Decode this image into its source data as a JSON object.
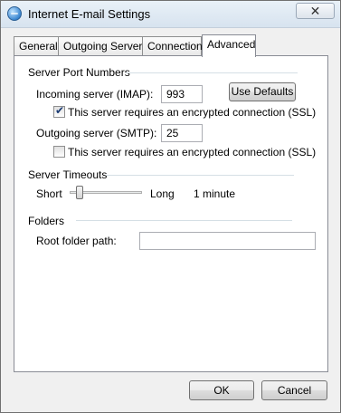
{
  "window": {
    "title": "Internet E-mail Settings",
    "close_glyph": "✕"
  },
  "tabs": [
    {
      "label": "General"
    },
    {
      "label": "Outgoing Server"
    },
    {
      "label": "Connection"
    },
    {
      "label": "Advanced"
    }
  ],
  "server_ports": {
    "group_title": "Server Port Numbers",
    "incoming_label": "Incoming server (IMAP):",
    "incoming_value": "993",
    "use_defaults_label": "Use Defaults",
    "incoming_ssl_label": "This server requires an encrypted connection (SSL)",
    "incoming_ssl_checked": true,
    "outgoing_label": "Outgoing server (SMTP):",
    "outgoing_value": "25",
    "outgoing_ssl_label": "This server requires an encrypted connection (SSL)",
    "outgoing_ssl_checked": false
  },
  "timeouts": {
    "group_title": "Server Timeouts",
    "short_label": "Short",
    "long_label": "Long",
    "value_text": "1 minute",
    "slider_fraction": 0.1
  },
  "folders": {
    "group_title": "Folders",
    "root_label": "Root folder path:",
    "root_value": ""
  },
  "footer": {
    "ok_label": "OK",
    "cancel_label": "Cancel"
  },
  "check_glyph": "✔"
}
